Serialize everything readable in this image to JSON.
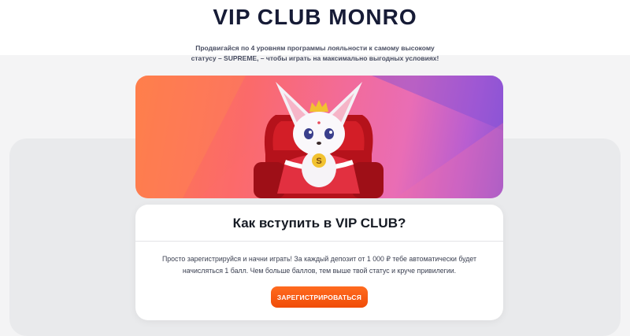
{
  "header": {
    "title": "VIP CLUB MONRO",
    "subtitle_line1": "Продвигайся по 4 уровням программы лояльности к самому высокому",
    "subtitle_line2": "статусу – SUPREME, – чтобы играть на максимально выгодных условиях!"
  },
  "hero": {
    "mascot_badge_letter": "S"
  },
  "join_card": {
    "title": "Как вступить в VIP CLUB?",
    "text_line1": "Просто зарегистрируйся и начни играть! За каждый депозит от 1 000 ₽ тебе автоматически будет",
    "text_line2": "начисляться 1 балл. Чем больше баллов, тем выше твой статус и круче привилегии.",
    "button_label": "ЗАРЕГИСТРИРОВАТЬСЯ"
  },
  "colors": {
    "accent": "#f04c08",
    "title": "#161b36",
    "hero_left": "#ff7a4a",
    "hero_right": "#8b56d6"
  }
}
